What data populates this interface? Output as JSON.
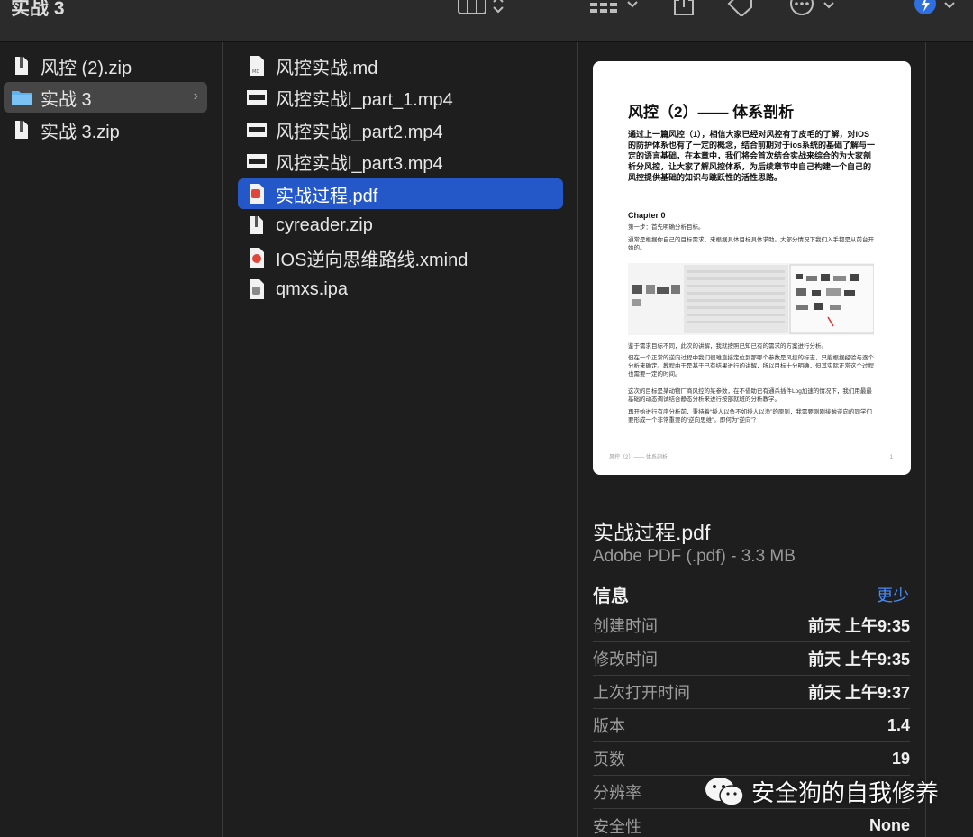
{
  "window": {
    "title": "实战 3"
  },
  "toolbar": {
    "icons": [
      "column-view-icon",
      "grid-view-icon",
      "share-icon",
      "tag-icon",
      "more-icon",
      "extension-icon"
    ]
  },
  "column1": {
    "items": [
      {
        "label": "风控 (2).zip",
        "icon": "zip-icon"
      },
      {
        "label": "实战 3",
        "icon": "folder-icon",
        "selected": true
      },
      {
        "label": "实战 3.zip",
        "icon": "zip-icon"
      }
    ]
  },
  "column2": {
    "items": [
      {
        "label": "风控实战.md",
        "icon": "markdown-file-icon"
      },
      {
        "label": "风控实战l_part_1.mp4",
        "icon": "video-file-icon"
      },
      {
        "label": "风控实战l_part2.mp4",
        "icon": "video-file-icon"
      },
      {
        "label": "风控实战l_part3.mp4",
        "icon": "video-file-icon"
      },
      {
        "label": "实战过程.pdf",
        "icon": "pdf-file-icon",
        "selected": true
      },
      {
        "label": "cyreader.zip",
        "icon": "zip-icon"
      },
      {
        "label": "IOS逆向思维路线.xmind",
        "icon": "xmind-file-icon"
      },
      {
        "label": "qmxs.ipa",
        "icon": "ipa-file-icon"
      }
    ]
  },
  "preview": {
    "doc_title": "风控（2）—— 体系剖析",
    "intro": "通过上一篇风控（1），相信大家已经对风控有了皮毛的了解，对IOS的防护体系也有了一定的概念，结合前期对于ios系统的基础了解与一定的语言基础，在本章中，我们将会首次结合实战来综合的为大家剖析分风控，让大家了解风控体系，为后续章节中自己构建一个自己的风控提供基础的知识与跳跃性的活性思路。",
    "chapter": "Chapter 0",
    "step": "第一步：首先明确分析目标。",
    "para1": "通常是根据你自己的目标需求，来根据具体目标具体求助。大部分情况下我们入手都是从前台开始的。",
    "para2": "鉴于需求目标不同，此次的讲解，我就按照已知已有的需求的方案进行分析。",
    "para3": "但在一个正常的逆向过程中我们很难直接定位到那哪个参数是风控的标志，只能根据经验与逐个分析来确定。教程由于是基于已有结果进行的讲解，所以目标十分明确，但其实际正常这个过程 也需要一定的时间。",
    "para4": "这次的目标是某动物厂商风控的某参数，在不借助已有通杀插件Log加速的情况下，我们用最最基础的动态调试结合静态分析来进行按部就班的分析教学。",
    "para5": "再开始进行有序分析前，秉持着“授人以鱼不如授人以渔”的原则，我需要刚刚接触逆向的同学们要形成一个非常重要的“逆向思维”。即何为“逆向”？",
    "footer_left": "风控（2）—— 体系剖析",
    "footer_right": "1"
  },
  "file": {
    "name": "实战过程.pdf",
    "kind_size": "Adobe PDF (.pdf) - 3.3 MB"
  },
  "info": {
    "heading": "信息",
    "more_label": "更少",
    "rows": [
      {
        "key": "创建时间",
        "value": "前天 上午9:35"
      },
      {
        "key": "修改时间",
        "value": "前天 上午9:35"
      },
      {
        "key": "上次打开时间",
        "value": "前天 上午9:37"
      },
      {
        "key": "版本",
        "value": "1.4"
      },
      {
        "key": "页数",
        "value": "19"
      },
      {
        "key": "分辨率",
        "value": ""
      },
      {
        "key": "安全性",
        "value": "None"
      }
    ]
  },
  "watermark": {
    "text": "安全狗的自我修养"
  }
}
